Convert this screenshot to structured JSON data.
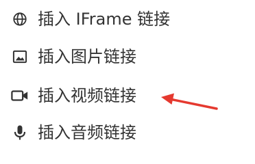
{
  "menu": {
    "items": [
      {
        "label": "插入 IFrame 链接",
        "icon": "globe-icon"
      },
      {
        "label": "插入图片链接",
        "icon": "image-icon"
      },
      {
        "label": "插入视频链接",
        "icon": "video-camera-icon"
      },
      {
        "label": "插入音频链接",
        "icon": "microphone-icon"
      }
    ]
  },
  "annotation": {
    "arrow_color": "#e5392f",
    "points_to": "插入视频链接"
  }
}
